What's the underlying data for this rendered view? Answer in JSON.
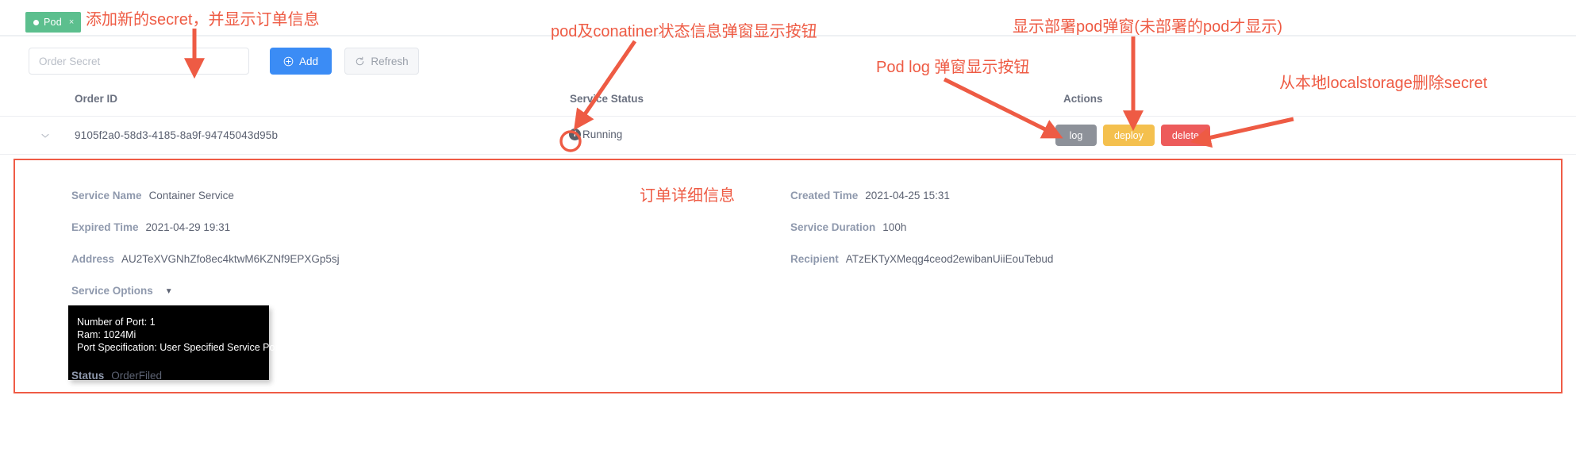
{
  "tabs": [
    {
      "label": "Pod",
      "status_dot": "#ffffff",
      "bg": "#5cbf8e",
      "close": "×"
    }
  ],
  "toolbar": {
    "secret_input_placeholder": "Order Secret",
    "secret_input_value": "",
    "add_label": "Add",
    "add_icon": "plus-circle-icon",
    "refresh_label": "Refresh",
    "refresh_icon": "refresh-icon"
  },
  "table": {
    "columns": {
      "order_id": "Order ID",
      "service_status": "Service Status",
      "actions": "Actions"
    },
    "rows": [
      {
        "expand_icon": "chevron-down-icon",
        "order_id": "9105f2a0-58d3-4185-8a9f-94745043d95b",
        "status_icon": "info-circle-icon",
        "status_icon_glyph": "i",
        "service_status": "Running",
        "actions": [
          {
            "label": "log",
            "color": "#8d9199"
          },
          {
            "label": "deploy",
            "color": "#f4c04e"
          },
          {
            "label": "delete",
            "color": "#ed5b5b"
          }
        ]
      }
    ]
  },
  "detail": {
    "border_color": "#ef5b46",
    "service_name": {
      "label": "Service Name",
      "value": "Container Service"
    },
    "expired_time": {
      "label": "Expired Time",
      "value": "2021-04-29 19:31"
    },
    "address": {
      "label": "Address",
      "value": "AU2TeXVGNhZfo8ec4ktwM6KZNf9EPXGp5sj"
    },
    "service_options": {
      "label": "Service Options",
      "caret": "▼"
    },
    "created_time": {
      "label": "Created Time",
      "value": "2021-04-25 15:31"
    },
    "service_duration": {
      "label": "Service Duration",
      "value": "100h"
    },
    "recipient": {
      "label": "Recipient",
      "value": "ATzEKTyXMeqg4ceod2ewibanUiiEouTebud"
    },
    "status": {
      "label": "Status",
      "value": "OrderFiled"
    },
    "options_tooltip": {
      "line1": "Number of Port: 1",
      "line2": "Ram: 1024Mi",
      "line3": "Port Specification: User Specified Service Port"
    }
  },
  "annotations": {
    "color": "#ee5b44",
    "add_secret": "添加新的secret，并显示订单信息",
    "pod_container_status": "pod及conatiner状态信息弹窗显示按钮",
    "deploy_popup": "显示部署pod弹窗(未部署的pod才显示)",
    "pod_log_popup": "Pod log 弹窗显示按钮",
    "delete_secret": "从本地localstorage删除secret",
    "order_detail": "订单详细信息"
  }
}
